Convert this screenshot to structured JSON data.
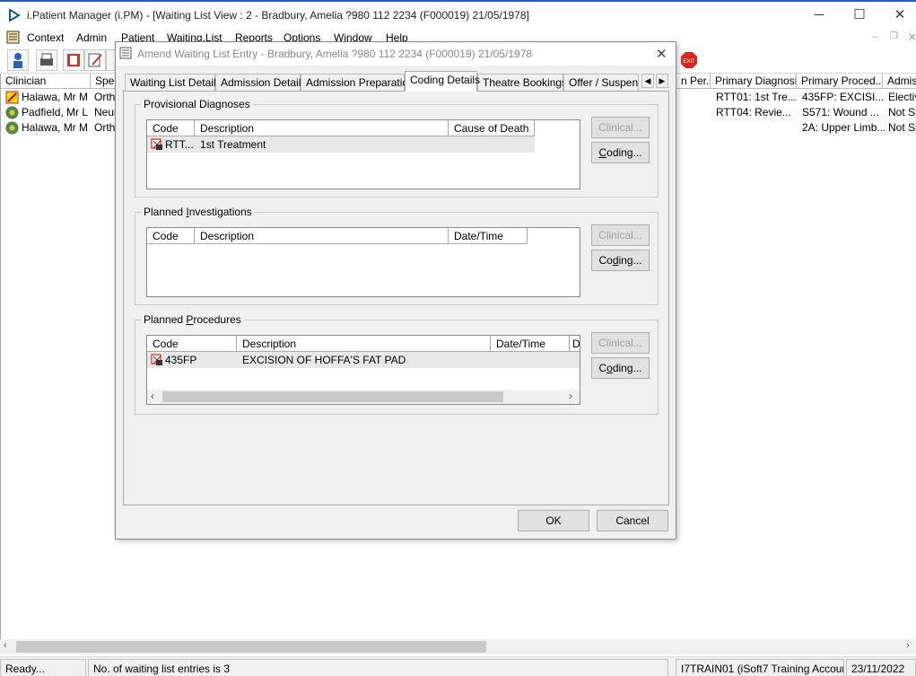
{
  "app": {
    "title": "i.Patient Manager (i.PM) - [Waiting List View :  2 - Bradbury, Amelia ?980 112 2234 (F000019) 21/05/1978]",
    "minimize": "─",
    "maximize": "☐",
    "close": "✕"
  },
  "menu": [
    "Context",
    "Admin",
    "Patient",
    "Waiting.List",
    "Reports",
    "Options",
    "Window",
    "Help"
  ],
  "list": {
    "columns": [
      "Clinician",
      "Spec",
      "n Per...",
      "Primary Diagnosis",
      "Primary Proced...",
      "Admiss"
    ],
    "rows": [
      {
        "clinician": "Halawa, Mr M",
        "spec": "Ortho",
        "diagnosis": "RTT01: 1st Tre...",
        "procedure": "435FP: EXCISI...",
        "admiss": "Electiv"
      },
      {
        "clinician": "Padfield, Mr L",
        "spec": "Neur",
        "diagnosis": "RTT04: Revie...",
        "procedure": "S571: Wound ...",
        "admiss": "Not Sp"
      },
      {
        "clinician": "Halawa, Mr M",
        "spec": "Ortho",
        "diagnosis": "",
        "procedure": "2A: Upper Limb...",
        "admiss": "Not Sp"
      }
    ]
  },
  "status": {
    "ready": "Ready...",
    "count": "No. of waiting list entries is 3",
    "account": "I7TRAIN01 (iSoft7 Training Account)",
    "date": "23/11/2022"
  },
  "dialog": {
    "title": "Amend Waiting List Entry - Bradbury, Amelia ?980 112 2234 (F000019) 21/05/1978",
    "tabs": [
      "Waiting List Details",
      "Admission Details",
      "Admission Preparation",
      "Coding Details",
      "Theatre Bookings",
      "Offer / Suspend"
    ],
    "active_tab": "Coding Details",
    "provisional": {
      "label": "Provisional Diagnoses",
      "columns": [
        "Code",
        "Description",
        "Cause of Death"
      ],
      "rows": [
        {
          "code": "RTT...",
          "description": "1st Treatment"
        }
      ],
      "clinical": "Clinical...",
      "coding": "Coding..."
    },
    "investigations": {
      "label": "Planned Investigations",
      "columns": [
        "Code",
        "Description",
        "Date/Time"
      ],
      "clinical": "Clinical...",
      "coding": "Coding..."
    },
    "procedures": {
      "label": "Planned Procedures",
      "columns": [
        "Code",
        "Description",
        "Date/Time",
        "D"
      ],
      "rows": [
        {
          "code": "435FP",
          "description": "EXCISION OF HOFFA'S FAT PAD"
        }
      ],
      "clinical": "Clinical...",
      "coding": "Coding..."
    },
    "ok": "OK",
    "cancel": "Cancel"
  }
}
